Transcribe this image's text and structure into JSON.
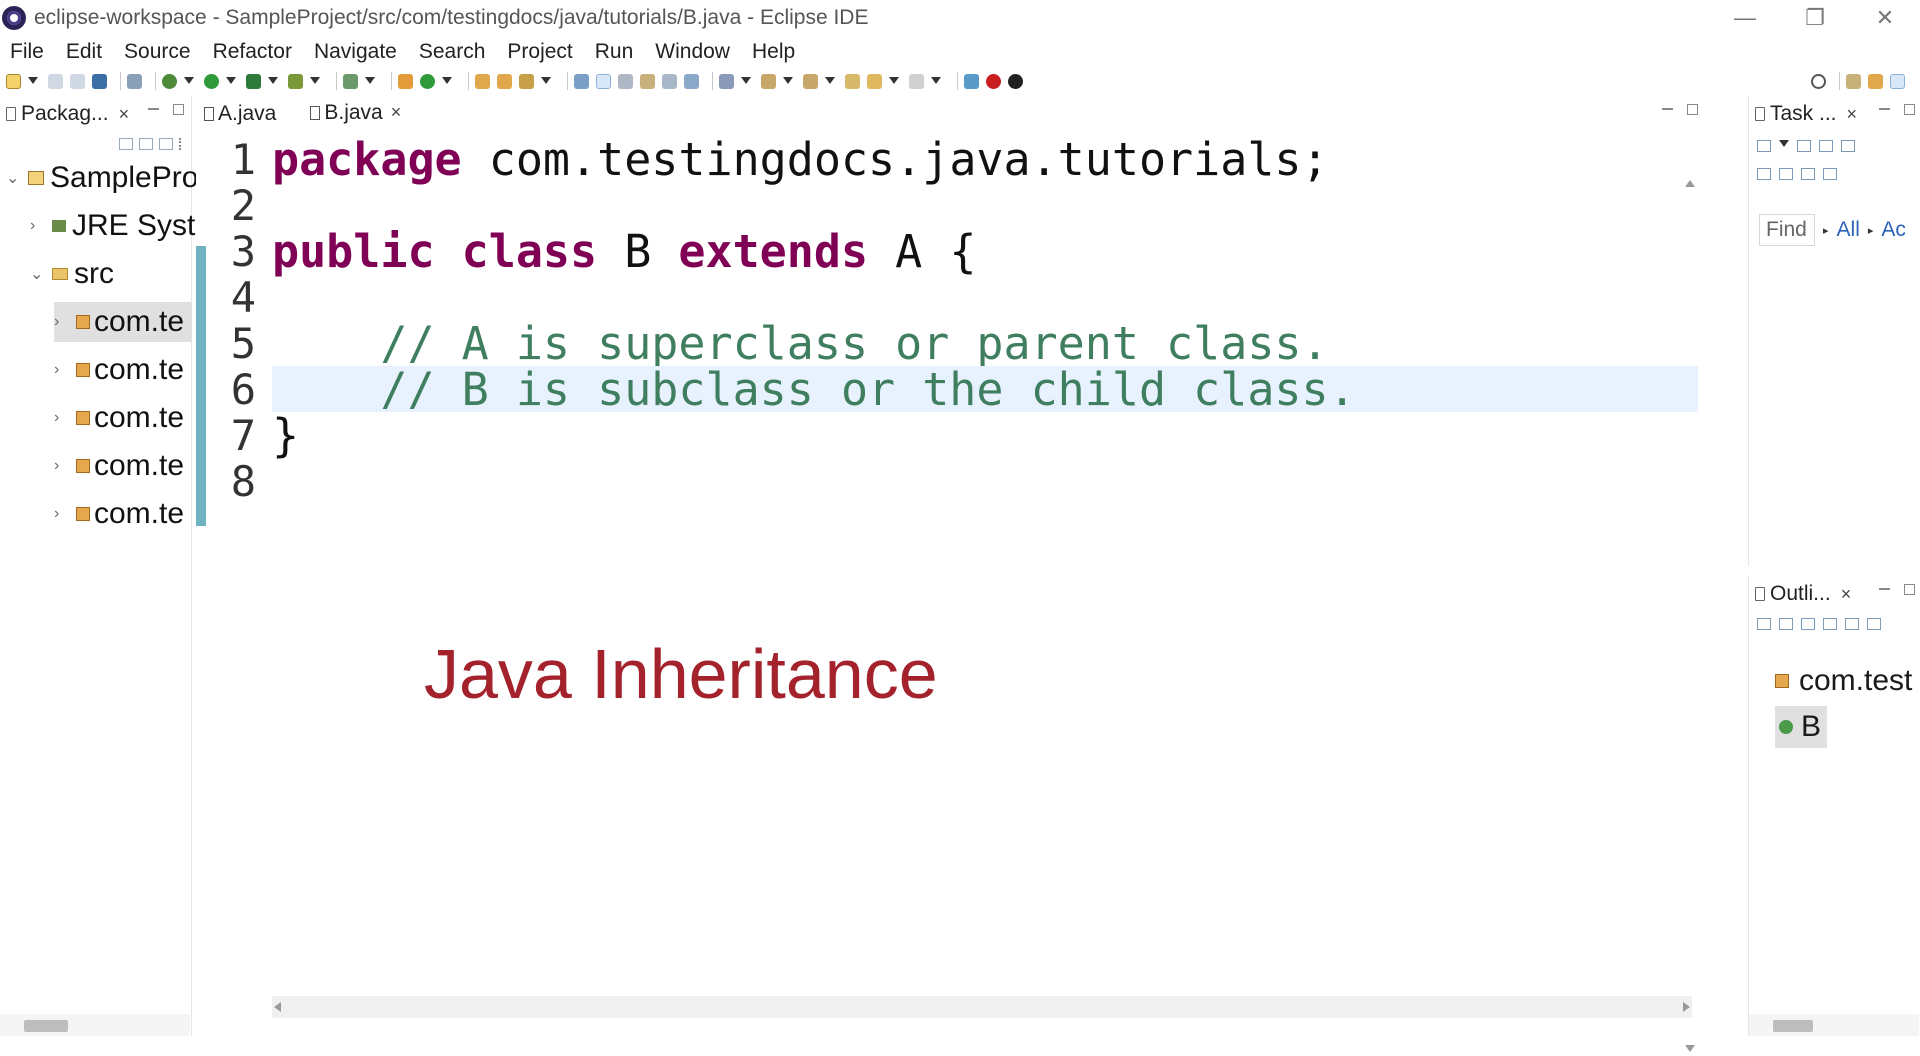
{
  "window": {
    "title": "eclipse-workspace - SampleProject/src/com/testingdocs/java/tutorials/B.java - Eclipse IDE",
    "minimize": "—",
    "restore": "❐",
    "close": "✕"
  },
  "menu": [
    "File",
    "Edit",
    "Source",
    "Refactor",
    "Navigate",
    "Search",
    "Project",
    "Run",
    "Window",
    "Help"
  ],
  "package_explorer": {
    "tab_label": "Packag...",
    "close": "×",
    "tree": {
      "project": "SamplePro",
      "jre": "JRE Syste",
      "src": "src",
      "packages": [
        "com.te",
        "com.te",
        "com.te",
        "com.te",
        "com.te"
      ]
    }
  },
  "editor": {
    "tabs": [
      {
        "label": "A.java",
        "active": false
      },
      {
        "label": "B.java",
        "active": true,
        "close": "×"
      }
    ],
    "line_numbers": [
      "1",
      "2",
      "3",
      "4",
      "5",
      "6",
      "7",
      "8"
    ],
    "lines": {
      "l1_kw": "package",
      "l1_rest": " com.testingdocs.java.tutorials;",
      "l3_kw1": "public",
      "l3_kw2": "class",
      "l3_mid": " B ",
      "l3_kw3": "extends",
      "l3_rest": " A {",
      "l5": "    // A is superclass or parent class.",
      "l6": "    // B is subclass or the child class.",
      "l7": "}"
    },
    "overlay_title": "Java Inheritance"
  },
  "task_list": {
    "tab_label": "Task ...",
    "close": "×",
    "find_placeholder": "Find",
    "all_link": "All",
    "activate_link": "Ac"
  },
  "outline": {
    "tab_label": "Outli...",
    "close": "×",
    "items": [
      "com.test",
      "B"
    ]
  }
}
